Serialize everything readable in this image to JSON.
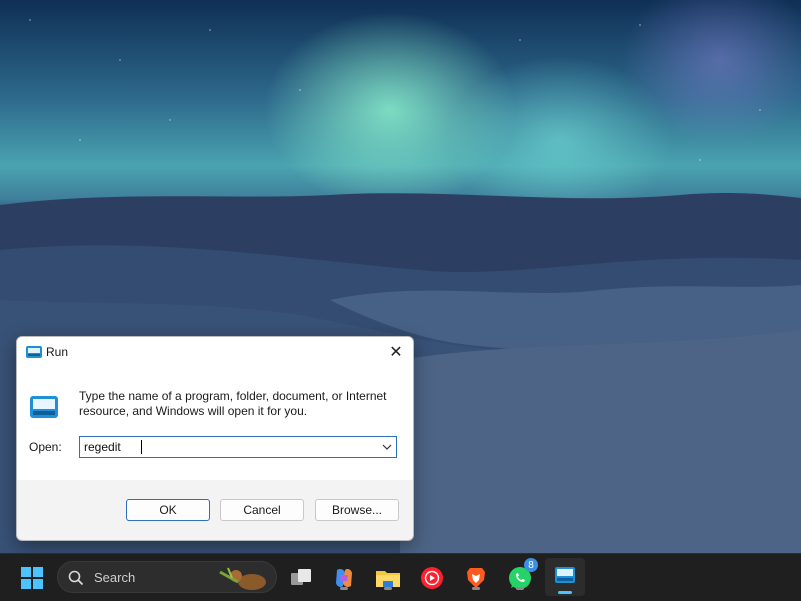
{
  "dialog": {
    "title": "Run",
    "description": "Type the name of a program, folder, document, or Internet resource, and Windows will open it for you.",
    "open_label": "Open:",
    "open_value": "regedit",
    "buttons": {
      "ok": "OK",
      "cancel": "Cancel",
      "browse": "Browse..."
    }
  },
  "taskbar": {
    "search_placeholder": "Search",
    "whatsapp_badge": "8",
    "items": [
      "start-icon",
      "search-icon",
      "task-view-icon",
      "copilot-icon",
      "file-explorer-icon",
      "youtube-music-icon",
      "brave-icon",
      "whatsapp-icon",
      "run-icon"
    ]
  },
  "colors": {
    "accent": "#2f6fbd",
    "taskbar_bg": "#1f1f1f",
    "active_indicator": "#4cc2ff"
  }
}
